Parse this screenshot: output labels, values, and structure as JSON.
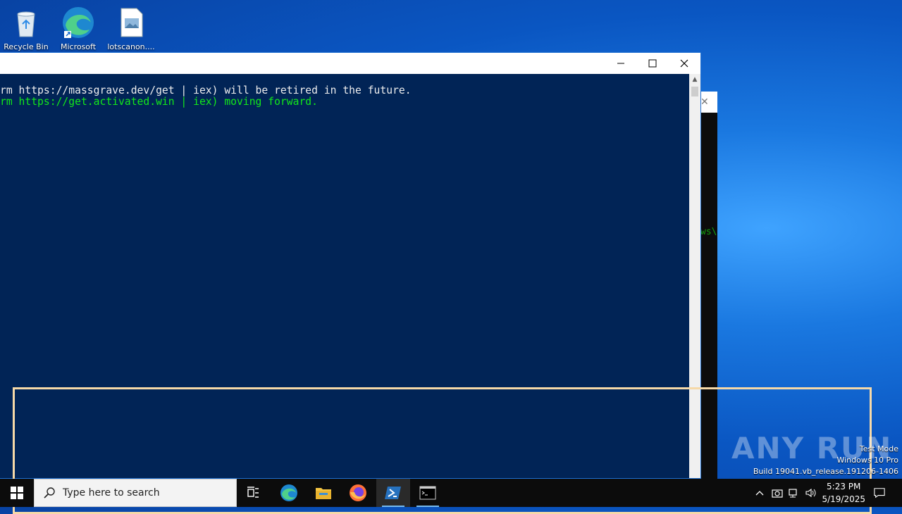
{
  "desktop": {
    "icons": [
      {
        "label": "Recycle Bin",
        "icon": "recycle-bin-icon"
      },
      {
        "label": "Microsoft",
        "icon": "edge-icon"
      },
      {
        "label": "lotscanon....",
        "icon": "image-file-icon"
      }
    ]
  },
  "console": {
    "line1": "rm https://massgrave.dev/get | iex) will be retired in the future.",
    "line2": "rm https://get.activated.win | iex) moving forward.",
    "line1_color": "#eeeeee",
    "line2_color": "#13e81a",
    "background": "#012456"
  },
  "background_console": {
    "close_glyph": "✕",
    "text": "ws\\"
  },
  "window_controls": {
    "minimize": "—",
    "maximize": "☐",
    "close": "✕"
  },
  "watermark": {
    "brand": "ANY RUN",
    "line1": "Test Mode",
    "line2": "Windows 10 Pro",
    "line3": "Build 19041.vb_release.191206-1406"
  },
  "taskbar": {
    "search_placeholder": "Type here to search",
    "apps": [
      "task-view-icon",
      "edge-icon",
      "file-explorer-icon",
      "firefox-icon",
      "powershell-icon",
      "cmd-icon"
    ],
    "time": "5:23 PM",
    "date": "5/19/2025"
  }
}
